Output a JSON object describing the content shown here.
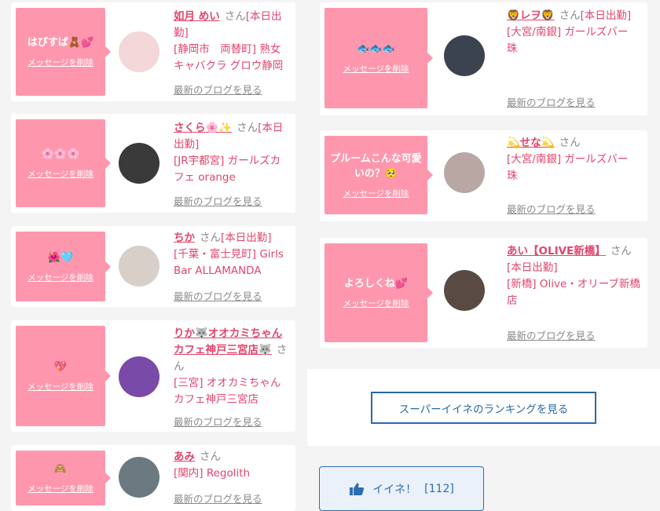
{
  "left_cards": [
    {
      "message": "はぴすば🧸💕",
      "delete": "メッセージを削除",
      "name": "如月 めい",
      "san": "さん",
      "status": "[本日出勤]",
      "shop": "[静岡市　両替町] 熟女キャバクラ グロウ静岡",
      "blog": "最新のブログを見る",
      "avatar_color": "#f3d7d9"
    },
    {
      "message": "🌸🌸🌸",
      "delete": "メッセージを削除",
      "name": "さくら🌸✨",
      "san": "さん",
      "status": "[本日出勤]",
      "shop": "[JR宇都宮] ガールズカフェ orange",
      "blog": "最新のブログを見る",
      "avatar_color": "#3a3a3a"
    },
    {
      "message": "🌺🩵",
      "delete": "メッセージを削除",
      "name": "ちか",
      "san": "さん",
      "status": "[本日出勤]",
      "shop": "[千葉・富士見町] Girls Bar ALLAMANDA",
      "blog": "最新のブログを見る",
      "avatar_color": "#d8cfc8"
    },
    {
      "message": "💖",
      "delete": "メッセージを削除",
      "name": "りか🐺オオカミちゃんカフェ神戸三宮店🐺",
      "san": "さん",
      "status": "",
      "shop": "[三宮] オオカミちゃんカフェ神戸三宮店",
      "blog": "最新のブログを見る",
      "avatar_color": "#7a4aa8"
    },
    {
      "message": "🙈",
      "delete": "メッセージを削除",
      "name": "あみ",
      "san": "さん",
      "status": "",
      "shop": "[関内] Regolith",
      "blog": "最新のブログを見る",
      "avatar_color": "#6a7a80"
    }
  ],
  "right_cards": [
    {
      "message": "🐟🐟🐟",
      "delete": "メッセージを削除",
      "name": "🦁レヲ🦁",
      "san": "さん",
      "status": "[本日出勤]",
      "shop": "[大宮/南銀] ガールズバー 珠",
      "blog": "最新のブログを見る",
      "avatar_color": "#3c4350"
    },
    {
      "message": "プルームこんな可愛いの？🥺",
      "delete": "メッセージを削除",
      "name": "💫せな💫",
      "san": "さん",
      "status": "",
      "shop": "[大宮/南銀] ガールズバー 珠",
      "blog": "最新のブログを見る",
      "avatar_color": "#b9a7a3"
    },
    {
      "message": "よろしくね💕",
      "delete": "メッセージを削除",
      "name": "あい【OLIVE新橋】",
      "san": "さん",
      "status": "[本日出勤]",
      "shop": "[新橋] Olive・オリーブ新橋店",
      "blog": "最新のブログを見る",
      "avatar_color": "#5a4a44"
    }
  ],
  "ranking_button": "スーパーイイネのランキングを見る",
  "like_button": {
    "label": "イイネ！",
    "count": "[112]",
    "icon": "thumbs-up-icon"
  }
}
